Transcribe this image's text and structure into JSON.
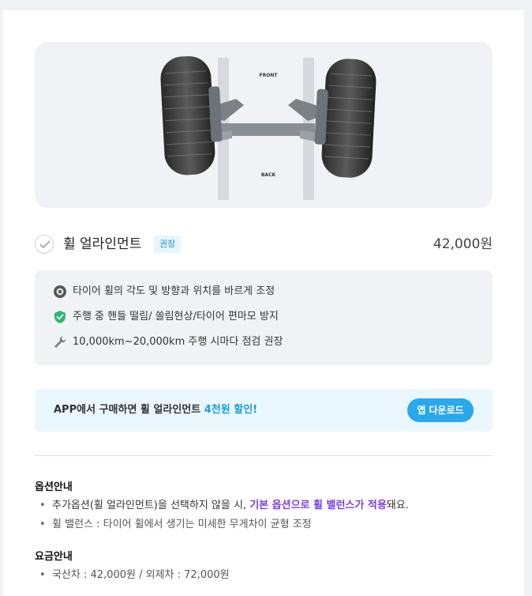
{
  "hero": {
    "image_icon": "wheel-alignment-diagram",
    "front_label": "FRONT",
    "back_label": "BACK"
  },
  "product": {
    "name": "휠 얼라인먼트",
    "badge": "권장",
    "price": "42,000원",
    "checked": false
  },
  "features": [
    {
      "icon": "tire-icon",
      "text": "타이어 휠의 각도 및 방향과 위치를 바르게 조정"
    },
    {
      "icon": "shield-check-icon",
      "text": "주행 중 핸들 떨림/ 쏠림현상/타이어 편마모 방지"
    },
    {
      "icon": "wrench-icon",
      "text": "10,000km~20,000km 주행 시마다 점검 권장"
    }
  ],
  "promo": {
    "text_before": "APP에서 구매하면 휠 얼라인먼트 ",
    "highlight": "4천원 할인!",
    "button_label": "앱 다운로드"
  },
  "options": {
    "title": "옵션안내",
    "bullet1_before": "추가옵션(휠 얼라인먼트)을 선택하지 않을 시, ",
    "bullet1_highlight": "기본 옵션으로 휠 밸런스가 적용",
    "bullet1_after": "돼요.",
    "bullet2": "휠 밸런스 : 타이어 휠에서 생기는 미세한 무게차이 균형 조정"
  },
  "pricing": {
    "title": "요금안내",
    "bullet1": "국산차 : 42,000원 / 외제차 : 72,000원"
  },
  "colors": {
    "accent_blue": "#2aa8ec",
    "highlight_purple": "#7b3fe4",
    "panel_gray": "#f1f2f5"
  }
}
